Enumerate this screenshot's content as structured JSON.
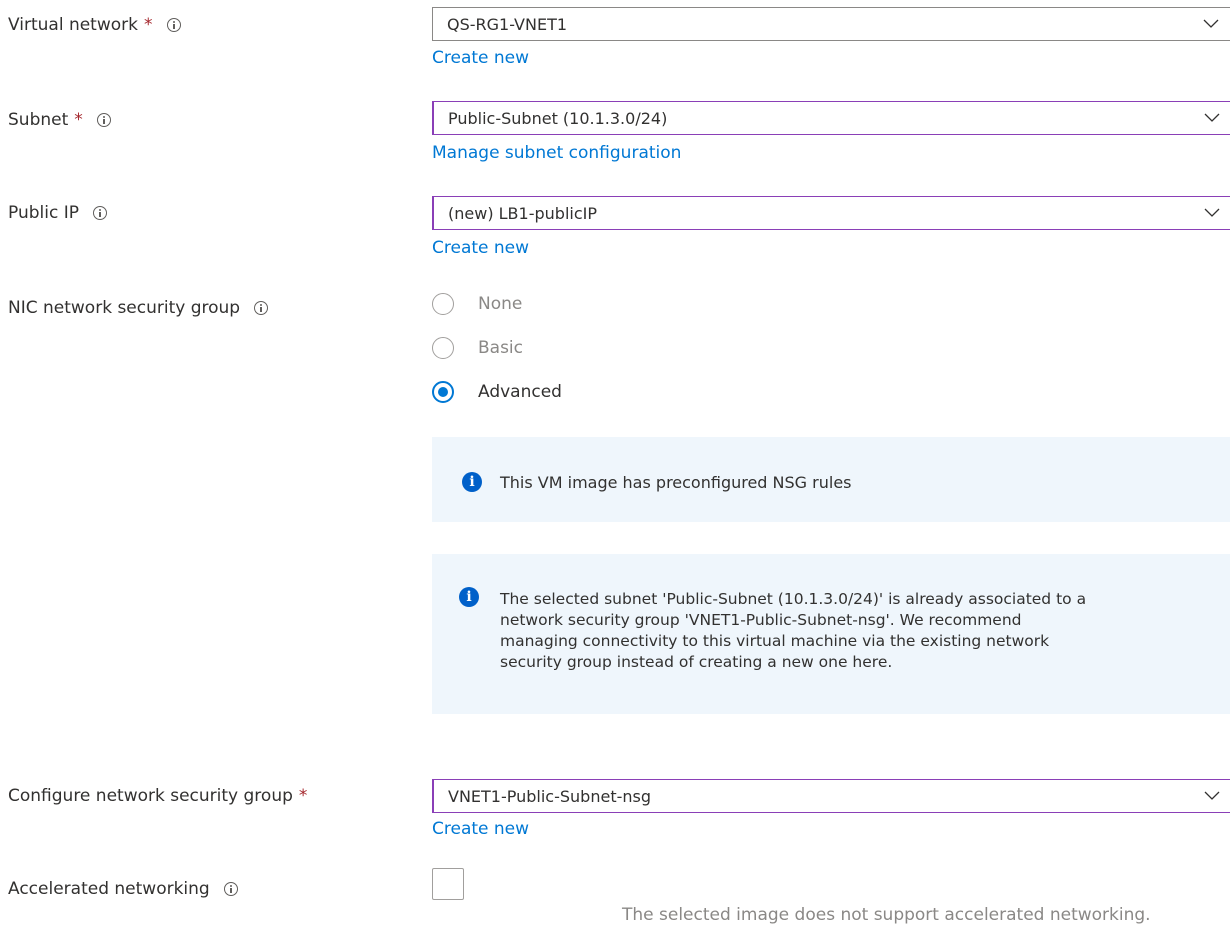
{
  "virtual_network": {
    "label": "Virtual network",
    "required_mark": "*",
    "info_icon": "info-icon",
    "value": "QS-RG1-VNET1",
    "link": "Create new"
  },
  "subnet": {
    "label": "Subnet",
    "required_mark": "*",
    "info_icon": "info-icon",
    "value": "Public-Subnet (10.1.3.0/24)",
    "link": "Manage subnet configuration"
  },
  "public_ip": {
    "label": "Public IP",
    "info_icon": "info-icon",
    "value": "(new) LB1-publicIP",
    "link": "Create new"
  },
  "nic_nsg": {
    "label": "NIC network security group",
    "info_icon": "info-icon",
    "options": [
      {
        "label": "None",
        "selected": false
      },
      {
        "label": "Basic",
        "selected": false
      },
      {
        "label": "Advanced",
        "selected": true
      }
    ],
    "info_box_1": "This VM image has preconfigured NSG rules",
    "info_box_2_lines": [
      "The selected subnet 'Public-Subnet (10.1.3.0/24)' is already associated to a",
      "network security group 'VNET1-Public-Subnet-nsg'. We recommend",
      "managing connectivity to this virtual machine via the existing network",
      "security group instead of creating a new one here."
    ]
  },
  "configure_nsg": {
    "label": "Configure network security group",
    "required_mark": "*",
    "value": "VNET1-Public-Subnet-nsg",
    "link": "Create new"
  },
  "accelerated_networking": {
    "label": "Accelerated networking",
    "info_icon": "info-icon",
    "checked": false,
    "note": "The selected image does not support accelerated networking."
  },
  "colors": {
    "link": "#0078d4",
    "required": "#a4262c",
    "focus_border": "#8a3fb7",
    "info_background": "#eff6fc",
    "info_icon": "#0060c9"
  }
}
